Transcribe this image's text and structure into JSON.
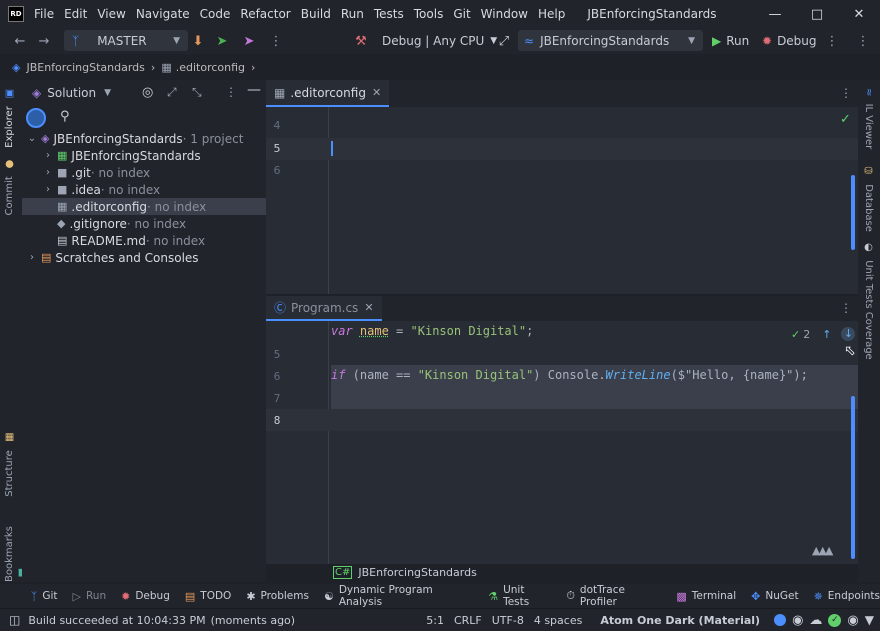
{
  "titlebar": {
    "logo": "RD",
    "menu": [
      "File",
      "Edit",
      "View",
      "Navigate",
      "Code",
      "Refactor",
      "Build",
      "Run",
      "Tests",
      "Tools",
      "Git",
      "Window",
      "Help"
    ],
    "window_title": "JBEnforcingStandards",
    "controls": [
      "minimize-icon",
      "maximize-icon",
      "close-icon"
    ]
  },
  "toolbar": {
    "branch": "MASTER",
    "config": "Debug | Any CPU",
    "run_config": "JBEnforcingStandards",
    "run_label": "Run",
    "debug_label": "Debug"
  },
  "breadcrumb": {
    "project": "JBEnforcingStandards",
    "file": ".editorconfig"
  },
  "left_strip": {
    "explorer": "Explorer",
    "commit": "Commit",
    "structure": "Structure",
    "bookmarks": "Bookmarks"
  },
  "right_strip": {
    "il_viewer": "IL Viewer",
    "database": "Database",
    "unit_tests_coverage": "Unit Tests Coverage"
  },
  "explorer": {
    "title": "Solution",
    "tree": [
      {
        "label": "JBEnforcingStandards",
        "suffix": " · 1 project",
        "indent": 0,
        "expanded": true,
        "icon": "solution-icon"
      },
      {
        "label": "JBEnforcingStandards",
        "suffix": "",
        "indent": 1,
        "expanded": false,
        "icon": "csproj-icon"
      },
      {
        "label": ".git",
        "suffix": " · no index",
        "indent": 1,
        "expanded": false,
        "icon": "folder-icon"
      },
      {
        "label": ".idea",
        "suffix": " · no index",
        "indent": 1,
        "expanded": false,
        "icon": "folder-icon"
      },
      {
        "label": ".editorconfig",
        "suffix": " · no index",
        "indent": 1,
        "selected": true,
        "icon": "editorconfig-icon"
      },
      {
        "label": ".gitignore",
        "suffix": " · no index",
        "indent": 1,
        "icon": "gitignore-icon"
      },
      {
        "label": "README.md",
        "suffix": " · no index",
        "indent": 1,
        "icon": "markdown-icon"
      },
      {
        "label": "Scratches and Consoles",
        "suffix": "",
        "indent": 0,
        "expanded": false,
        "icon": "scratches-icon"
      }
    ]
  },
  "editor_top": {
    "tab": ".editorconfig",
    "line_numbers": [
      "4",
      "5",
      "6"
    ],
    "current_line": "5"
  },
  "editor_bottom": {
    "tab": "Program.cs",
    "line_numbers": [
      "5",
      "6",
      "7",
      "8"
    ],
    "current_line": "8",
    "inspection_count": "2",
    "code": {
      "line4_kw": "var",
      "line4_name": "name",
      "line4_rest": " = ",
      "line4_str": "\"Kinson Digital\"",
      "line4_end": ";",
      "line6_kw": "if",
      "line6_a": " (name == ",
      "line6_str": "\"Kinson Digital\"",
      "line6_b": ") Console.",
      "line6_method": "WriteLine",
      "line6_c": "($\"Hello, {name}\");"
    },
    "breadcrumb": "JBEnforcingStandards"
  },
  "bottom_tools": [
    {
      "label": "Git",
      "icon": "git-icon"
    },
    {
      "label": "Run",
      "icon": "run-icon"
    },
    {
      "label": "Debug",
      "icon": "debug-icon"
    },
    {
      "label": "TODO",
      "icon": "todo-icon"
    },
    {
      "label": "Problems",
      "icon": "problems-icon"
    },
    {
      "label": "Dynamic Program Analysis",
      "icon": "dpa-icon"
    },
    {
      "label": "Unit Tests",
      "icon": "unit-tests-icon"
    },
    {
      "label": "dotTrace Profiler",
      "icon": "dottrace-icon"
    },
    {
      "label": "Terminal",
      "icon": "terminal-icon"
    },
    {
      "label": "NuGet",
      "icon": "nuget-icon"
    },
    {
      "label": "Endpoints",
      "icon": "endpoints-icon"
    }
  ],
  "status": {
    "message": "Build succeeded at 10:04:33 PM",
    "time_ago": "(moments ago)",
    "position": "5:1",
    "line_ending": "CRLF",
    "encoding": "UTF-8",
    "indent": "4 spaces",
    "theme": "Atom One Dark (Material)"
  },
  "colors": {
    "accent": "#4d8eff",
    "keyword": "#c678dd",
    "string": "#98c379",
    "method": "#61afef",
    "run_green": "#61d06b",
    "debug_red": "#e06c75"
  }
}
